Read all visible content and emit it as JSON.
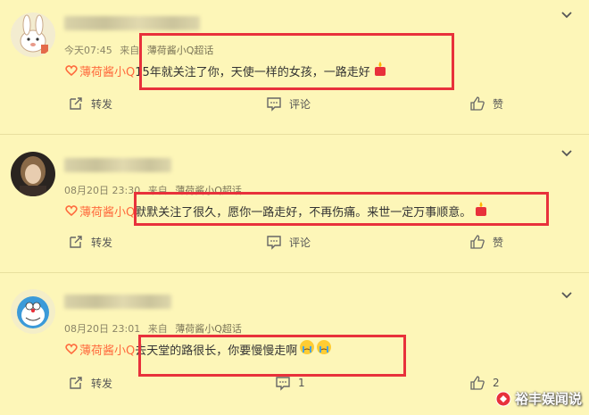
{
  "comments": [
    {
      "time": "今天07:45",
      "from_label": "来自",
      "source": "薄荷酱小Q超话",
      "fan_badge": "薄荷酱小Q",
      "text": "15年就关注了你，天使一样的女孩，一路走好",
      "emoji": "candle",
      "repost_label": "转发",
      "comment_label": "评论",
      "like_label": "赞"
    },
    {
      "time": "08月20日 23:30",
      "from_label": "来自",
      "source": "薄荷酱小Q超话",
      "fan_badge": "薄荷酱小Q",
      "text": "默默关注了很久，愿你一路走好，不再伤痛。来世一定万事顺意。",
      "emoji": "candle",
      "repost_label": "转发",
      "comment_label": "评论",
      "like_label": "赞"
    },
    {
      "time": "08月20日 23:01",
      "from_label": "来自",
      "source": "薄荷酱小Q超话",
      "fan_badge": "薄荷酱小Q",
      "text": "去天堂的路很长，你要慢慢走啊",
      "emoji": "crying-faces",
      "repost_label": "转发",
      "comment_count": "1",
      "like_count": "2"
    }
  ],
  "watermark": "裕丰娱闻说",
  "colors": {
    "background": "#fdf6b8",
    "highlight": "#e8313b",
    "badge": "#ff6a3d"
  }
}
